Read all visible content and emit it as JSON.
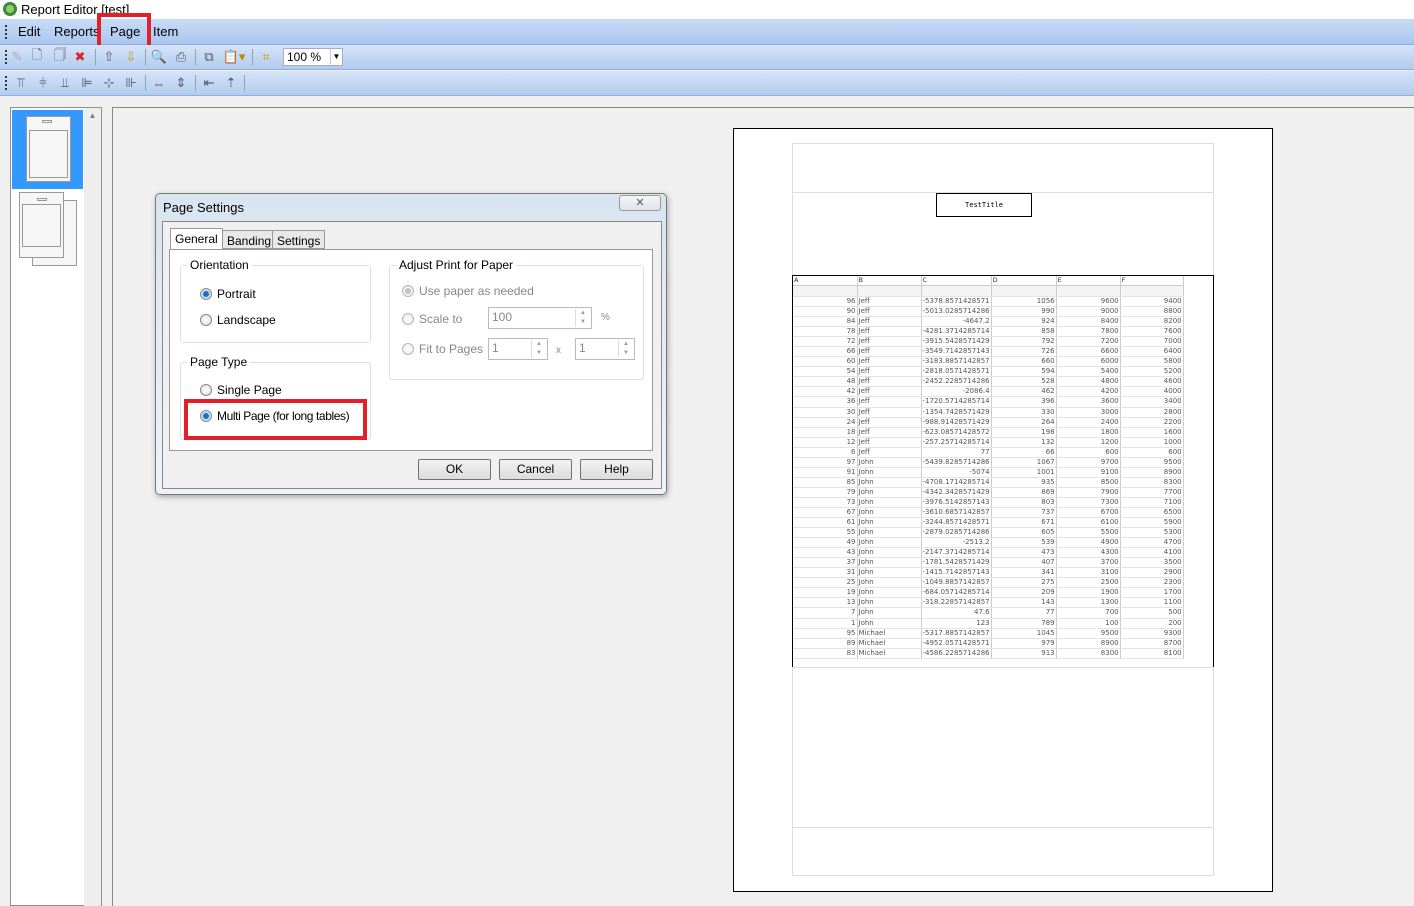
{
  "window": {
    "title": "Report Editor [test]"
  },
  "menu": [
    "Edit",
    "Reports",
    "Page",
    "Item"
  ],
  "toolbar": {
    "zoom": "100 %"
  },
  "report": {
    "title": "TestTitle",
    "columns": [
      "A",
      "B",
      "C",
      "D",
      "E",
      "F"
    ],
    "rows": [
      [
        "96",
        "Jeff",
        "-5378.8571428571",
        "1056",
        "9600",
        "9400"
      ],
      [
        "90",
        "Jeff",
        "-5013.0285714286",
        "990",
        "9000",
        "8800"
      ],
      [
        "84",
        "Jeff",
        "-4647.2",
        "924",
        "8400",
        "8200"
      ],
      [
        "78",
        "Jeff",
        "-4281.3714285714",
        "858",
        "7800",
        "7600"
      ],
      [
        "72",
        "Jeff",
        "-3915.5428571429",
        "792",
        "7200",
        "7000"
      ],
      [
        "66",
        "Jeff",
        "-3549.7142857143",
        "726",
        "6600",
        "6400"
      ],
      [
        "60",
        "Jeff",
        "-3183.8857142857",
        "660",
        "6000",
        "5800"
      ],
      [
        "54",
        "Jeff",
        "-2818.0571428571",
        "594",
        "5400",
        "5200"
      ],
      [
        "48",
        "Jeff",
        "-2452.2285714286",
        "528",
        "4800",
        "4600"
      ],
      [
        "42",
        "Jeff",
        "-2086.4",
        "462",
        "4200",
        "4000"
      ],
      [
        "36",
        "Jeff",
        "-1720.5714285714",
        "396",
        "3600",
        "3400"
      ],
      [
        "30",
        "Jeff",
        "-1354.7428571429",
        "330",
        "3000",
        "2800"
      ],
      [
        "24",
        "Jeff",
        "-988.91428571429",
        "264",
        "2400",
        "2200"
      ],
      [
        "18",
        "Jeff",
        "-623.08571428572",
        "198",
        "1800",
        "1600"
      ],
      [
        "12",
        "Jeff",
        "-257.25714285714",
        "132",
        "1200",
        "1000"
      ],
      [
        "6",
        "Jeff",
        "77",
        "66",
        "600",
        "600"
      ],
      [
        "97",
        "John",
        "-5439.8285714286",
        "1067",
        "9700",
        "9500"
      ],
      [
        "91",
        "John",
        "-5074",
        "1001",
        "9100",
        "8900"
      ],
      [
        "85",
        "John",
        "-4708.1714285714",
        "935",
        "8500",
        "8300"
      ],
      [
        "79",
        "John",
        "-4342.3428571429",
        "869",
        "7900",
        "7700"
      ],
      [
        "73",
        "John",
        "-3976.5142857143",
        "803",
        "7300",
        "7100"
      ],
      [
        "67",
        "John",
        "-3610.6857142857",
        "737",
        "6700",
        "6500"
      ],
      [
        "61",
        "John",
        "-3244.8571428571",
        "671",
        "6100",
        "5900"
      ],
      [
        "55",
        "John",
        "-2879.0285714286",
        "605",
        "5500",
        "5300"
      ],
      [
        "49",
        "John",
        "-2513.2",
        "539",
        "4900",
        "4700"
      ],
      [
        "43",
        "John",
        "-2147.3714285714",
        "473",
        "4300",
        "4100"
      ],
      [
        "37",
        "John",
        "-1781.5428571429",
        "407",
        "3700",
        "3500"
      ],
      [
        "31",
        "John",
        "-1415.7142857143",
        "341",
        "3100",
        "2900"
      ],
      [
        "25",
        "John",
        "-1049.8857142857",
        "275",
        "2500",
        "2300"
      ],
      [
        "19",
        "John",
        "-684.05714285714",
        "209",
        "1900",
        "1700"
      ],
      [
        "13",
        "John",
        "-318.22857142857",
        "143",
        "1300",
        "1100"
      ],
      [
        "7",
        "John",
        "47.6",
        "77",
        "700",
        "500"
      ],
      [
        "1",
        "John",
        "123",
        "789",
        "100",
        "200"
      ],
      [
        "95",
        "Michael",
        "-5317.8857142857",
        "1045",
        "9500",
        "9300"
      ],
      [
        "89",
        "Michael",
        "-4952.0571428571",
        "979",
        "8900",
        "8700"
      ],
      [
        "83",
        "Michael",
        "-4586.2285714286",
        "913",
        "8300",
        "8100"
      ]
    ]
  },
  "dialog": {
    "title": "Page Settings",
    "close": "✕",
    "tabs": [
      "General",
      "Banding",
      "Settings"
    ],
    "orientation": {
      "legend": "Orientation",
      "portrait": "Portrait",
      "landscape": "Landscape"
    },
    "page_type": {
      "legend": "Page Type",
      "single": "Single Page",
      "multi": "Multi Page (for long tables)"
    },
    "adjust": {
      "legend": "Adjust Print for Paper",
      "use_paper": "Use paper as needed",
      "scale_to": "Scale to",
      "scale_value": "100",
      "percent": "%",
      "fit_to": "Fit to Pages",
      "fit_w": "1",
      "x": "x",
      "fit_h": "1"
    },
    "buttons": {
      "ok": "OK",
      "cancel": "Cancel",
      "help": "Help"
    }
  }
}
